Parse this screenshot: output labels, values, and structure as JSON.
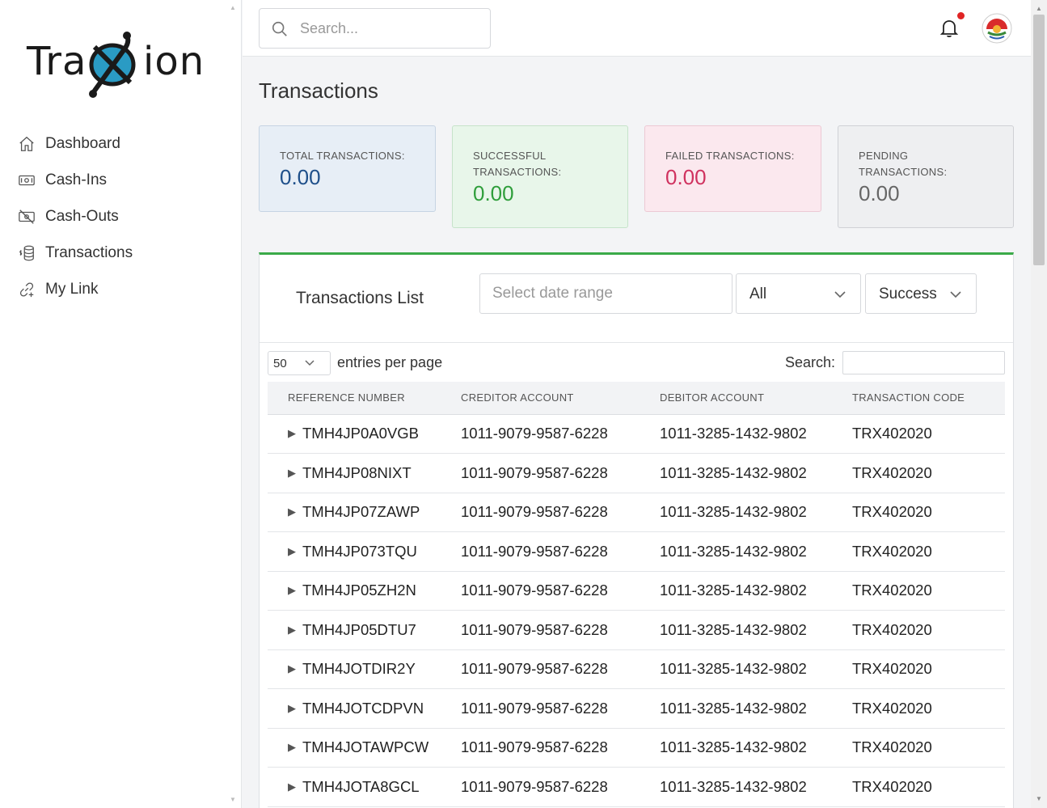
{
  "brand": {
    "name_left": "Tra",
    "name_right": "ion"
  },
  "nav": [
    {
      "label": "Dashboard",
      "icon": "home-icon"
    },
    {
      "label": "Cash-Ins",
      "icon": "cash-icon"
    },
    {
      "label": "Cash-Outs",
      "icon": "cash-off-icon"
    },
    {
      "label": "Transactions",
      "icon": "coins-icon"
    },
    {
      "label": "My Link",
      "icon": "link-icon"
    }
  ],
  "topbar": {
    "search_placeholder": "Search..."
  },
  "page_title": "Transactions",
  "stats": {
    "total": {
      "label": "TOTAL TRANSACTIONS:",
      "value": "0.00"
    },
    "successful": {
      "label": "SUCCESSFUL TRANSACTIONS:",
      "value": "0.00"
    },
    "failed": {
      "label": "FAILED TRANSACTIONS:",
      "value": "0.00"
    },
    "pending": {
      "label": "PENDING TRANSACTIONS:",
      "value": "0.00"
    }
  },
  "list": {
    "title": "Transactions List",
    "date_placeholder": "Select date range",
    "type_filter": "All",
    "status_filter": "Success",
    "entries_value": "50",
    "entries_label": "entries per page",
    "search_label": "Search:",
    "columns": [
      "REFERENCE NUMBER",
      "CREDITOR ACCOUNT",
      "DEBITOR ACCOUNT",
      "TRANSACTION CODE"
    ],
    "rows": [
      [
        "TMH4JP0A0VGB",
        "1011-9079-9587-6228",
        "1011-3285-1432-9802",
        "TRX402020"
      ],
      [
        "TMH4JP08NIXT",
        "1011-9079-9587-6228",
        "1011-3285-1432-9802",
        "TRX402020"
      ],
      [
        "TMH4JP07ZAWP",
        "1011-9079-9587-6228",
        "1011-3285-1432-9802",
        "TRX402020"
      ],
      [
        "TMH4JP073TQU",
        "1011-9079-9587-6228",
        "1011-3285-1432-9802",
        "TRX402020"
      ],
      [
        "TMH4JP05ZH2N",
        "1011-9079-9587-6228",
        "1011-3285-1432-9802",
        "TRX402020"
      ],
      [
        "TMH4JP05DTU7",
        "1011-9079-9587-6228",
        "1011-3285-1432-9802",
        "TRX402020"
      ],
      [
        "TMH4JOTDIR2Y",
        "1011-9079-9587-6228",
        "1011-3285-1432-9802",
        "TRX402020"
      ],
      [
        "TMH4JOTCDPVN",
        "1011-9079-9587-6228",
        "1011-3285-1432-9802",
        "TRX402020"
      ],
      [
        "TMH4JOTAWPCW",
        "1011-9079-9587-6228",
        "1011-3285-1432-9802",
        "TRX402020"
      ],
      [
        "TMH4JOTA8GCL",
        "1011-9079-9587-6228",
        "1011-3285-1432-9802",
        "TRX402020"
      ]
    ]
  },
  "colors": {
    "accent_green": "#3aaa48",
    "total_value": "#1e4f8a",
    "success_value": "#2f9e3b",
    "failed_value": "#d0325f",
    "pending_value": "#666666",
    "notification_dot": "#e02424"
  }
}
